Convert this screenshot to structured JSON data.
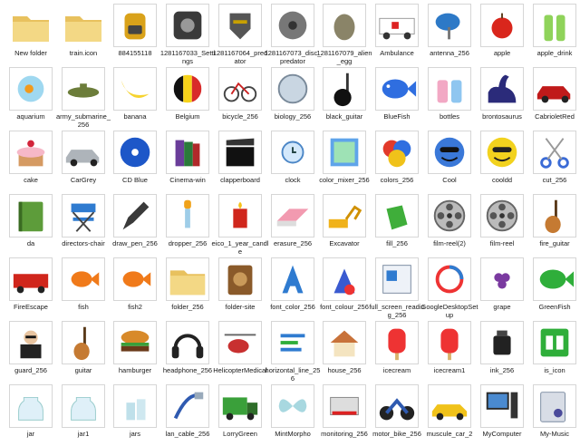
{
  "files": [
    {
      "label": "New folder",
      "icon": "folder-icon"
    },
    {
      "label": "train.icon",
      "icon": "folder-icon"
    },
    {
      "label": "884155118",
      "icon": "backpack-icon"
    },
    {
      "label": "1281167033_Settings",
      "icon": "settings-icon"
    },
    {
      "label": "1281167064_predator",
      "icon": "predator-icon"
    },
    {
      "label": "1281167073_disc_predator",
      "icon": "disc-predator-icon"
    },
    {
      "label": "1281167079_alien_egg",
      "icon": "alien-egg-icon"
    },
    {
      "label": "Ambulance",
      "icon": "ambulance-icon"
    },
    {
      "label": "antenna_256",
      "icon": "antenna-icon"
    },
    {
      "label": "apple",
      "icon": "apple-icon"
    },
    {
      "label": "apple_drink",
      "icon": "apple-drink-icon"
    },
    {
      "label": "aquarium",
      "icon": "aquarium-icon"
    },
    {
      "label": "army_submarine_256",
      "icon": "submarine-icon"
    },
    {
      "label": "banana",
      "icon": "banana-icon"
    },
    {
      "label": "Belgium",
      "icon": "belgium-flag-icon"
    },
    {
      "label": "bicycle_256",
      "icon": "bicycle-icon"
    },
    {
      "label": "biology_256",
      "icon": "biology-icon"
    },
    {
      "label": "black_guitar",
      "icon": "black-guitar-icon"
    },
    {
      "label": "BlueFish",
      "icon": "bluefish-icon"
    },
    {
      "label": "bottles",
      "icon": "bottles-icon"
    },
    {
      "label": "brontosaurus",
      "icon": "brontosaurus-icon"
    },
    {
      "label": "CabrioletRed",
      "icon": "cabriolet-icon"
    },
    {
      "label": "cake",
      "icon": "cake-icon"
    },
    {
      "label": "CarGrey",
      "icon": "car-icon"
    },
    {
      "label": "CD Blue",
      "icon": "cd-icon"
    },
    {
      "label": "Cinema-win",
      "icon": "cinema-icon"
    },
    {
      "label": "clapperboard",
      "icon": "clapperboard-icon"
    },
    {
      "label": "clock",
      "icon": "clock-icon"
    },
    {
      "label": "color_mixer_256",
      "icon": "color-mixer-icon"
    },
    {
      "label": "colors_256",
      "icon": "colors-icon"
    },
    {
      "label": "Cool",
      "icon": "cool-smiley-icon"
    },
    {
      "label": "cooldd",
      "icon": "cooldd-smiley-icon"
    },
    {
      "label": "cut_256",
      "icon": "scissors-icon"
    },
    {
      "label": "da",
      "icon": "notebook-icon"
    },
    {
      "label": "directors-chair",
      "icon": "directors-chair-icon"
    },
    {
      "label": "draw_pen_256",
      "icon": "pen-icon"
    },
    {
      "label": "dropper_256",
      "icon": "dropper-icon"
    },
    {
      "label": "eico_1_year_candle",
      "icon": "candle-icon"
    },
    {
      "label": "erasure_256",
      "icon": "eraser-icon"
    },
    {
      "label": "Excavator",
      "icon": "excavator-icon"
    },
    {
      "label": "fill_256",
      "icon": "fill-bucket-icon"
    },
    {
      "label": "film-reel(2)",
      "icon": "film-reel-icon"
    },
    {
      "label": "film-reel",
      "icon": "film-reel-icon"
    },
    {
      "label": "fire_guitar",
      "icon": "fire-guitar-icon"
    },
    {
      "label": "FireEscape",
      "icon": "fire-truck-icon"
    },
    {
      "label": "fish",
      "icon": "goldfish-icon"
    },
    {
      "label": "fish2",
      "icon": "goldfish-icon"
    },
    {
      "label": "folder_256",
      "icon": "folder-icon"
    },
    {
      "label": "folder-site",
      "icon": "folder-site-icon"
    },
    {
      "label": "font_color_256",
      "icon": "font-color-icon"
    },
    {
      "label": "font_colour_256",
      "icon": "font-colour-icon"
    },
    {
      "label": "full_screen_reading_256",
      "icon": "reading-icon"
    },
    {
      "label": "GoogleDesktopSetup",
      "icon": "google-desktop-icon"
    },
    {
      "label": "grape",
      "icon": "grape-icon"
    },
    {
      "label": "GreenFish",
      "icon": "greenfish-icon"
    },
    {
      "label": "guard_256",
      "icon": "guard-icon"
    },
    {
      "label": "guitar",
      "icon": "guitar-icon"
    },
    {
      "label": "hamburger",
      "icon": "hamburger-icon"
    },
    {
      "label": "headphone_256",
      "icon": "headphone-icon"
    },
    {
      "label": "HelicopterMedical",
      "icon": "helicopter-icon"
    },
    {
      "label": "horizontal_line_256",
      "icon": "horizontal-line-icon"
    },
    {
      "label": "house_256",
      "icon": "house-icon"
    },
    {
      "label": "icecream",
      "icon": "icecream-icon"
    },
    {
      "label": "icecream1",
      "icon": "icecream-icon"
    },
    {
      "label": "ink_256",
      "icon": "ink-icon"
    },
    {
      "label": "is_icon",
      "icon": "book-icon"
    },
    {
      "label": "jar",
      "icon": "jar-icon"
    },
    {
      "label": "jar1",
      "icon": "jar-icon"
    },
    {
      "label": "jars",
      "icon": "jars-icon"
    },
    {
      "label": "lan_cable_256",
      "icon": "lan-cable-icon"
    },
    {
      "label": "LorryGreen",
      "icon": "lorry-icon"
    },
    {
      "label": "MintMorpho",
      "icon": "butterfly-icon"
    },
    {
      "label": "monitoring_256",
      "icon": "monitoring-icon"
    },
    {
      "label": "motor_bike_256",
      "icon": "motorbike-icon"
    },
    {
      "label": "muscule_car_2",
      "icon": "muscle-car-icon"
    },
    {
      "label": "MyComputer",
      "icon": "computer-icon"
    },
    {
      "label": "My-Music",
      "icon": "music-icon"
    }
  ]
}
